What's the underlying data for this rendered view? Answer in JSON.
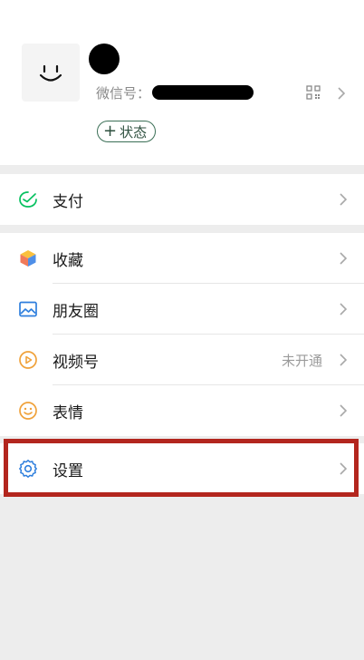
{
  "profile": {
    "wechat_id_label": "微信号：",
    "wechat_id_value": "",
    "status_label": "状态",
    "status_plus": "+"
  },
  "menu": {
    "pay": {
      "label": "支付"
    },
    "favorites": {
      "label": "收藏"
    },
    "moments": {
      "label": "朋友圈"
    },
    "channels": {
      "label": "视频号",
      "status": "未开通"
    },
    "stickers": {
      "label": "表情"
    },
    "settings": {
      "label": "设置"
    }
  },
  "colors": {
    "accent_green": "#07c160",
    "highlight": "#b3261e",
    "background": "#ededed"
  },
  "icons": {
    "pay": "wallet-check-icon",
    "favorites": "cube-icon",
    "moments": "picture-icon",
    "channels": "play-circle-icon",
    "stickers": "smile-icon",
    "settings": "gear-icon"
  }
}
